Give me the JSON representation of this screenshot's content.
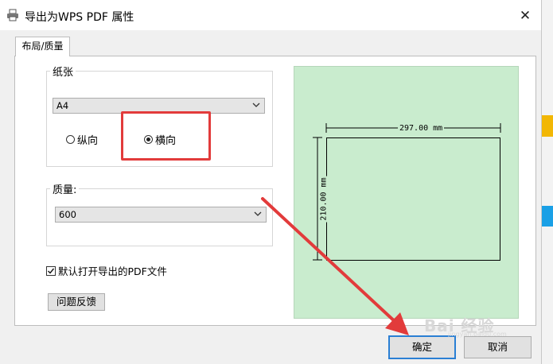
{
  "window": {
    "title": "导出为WPS PDF 属性",
    "close_glyph": "✕"
  },
  "tabs": [
    {
      "label": "布局/质量"
    }
  ],
  "paper": {
    "group_label": "纸张",
    "size_value": "A4",
    "orientation_options": [
      {
        "label": "纵向",
        "selected": false
      },
      {
        "label": "横向",
        "selected": true
      }
    ]
  },
  "quality": {
    "group_label": "质量:",
    "value": "600"
  },
  "open_pdf": {
    "label": "默认打开导出的PDF文件",
    "checked": true
  },
  "feedback_button": "问题反馈",
  "preview": {
    "width_label": "297.00 mm",
    "height_label": "210.00 mm"
  },
  "footer": {
    "ok_label": "确定",
    "cancel_label": "取消"
  },
  "watermark": {
    "text": "Bai 经验",
    "sub": "jingyan.baidu.com"
  },
  "colors": {
    "preview_bg": "#c9ecce",
    "annotation_red": "#e23b3b",
    "primary_border": "#2a7fd4"
  },
  "icons": [
    "printer-icon",
    "close-icon",
    "chevron-down-icon",
    "checkmark-icon",
    "red-arrow"
  ]
}
